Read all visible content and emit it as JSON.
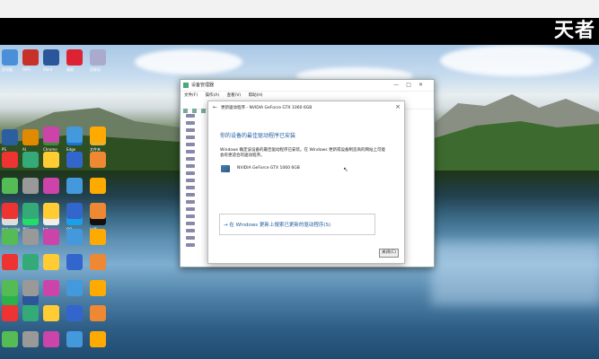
{
  "brand_text": "天者",
  "device_manager": {
    "title": "设备管理器",
    "menu": [
      "文件(F)",
      "操作(A)",
      "查看(V)",
      "帮助(H)"
    ],
    "controls": [
      "—",
      "□",
      "✕"
    ]
  },
  "update_dialog": {
    "title": "更新驱动程序 - NVIDIA GeForce GTX 1060 6GB",
    "heading": "你的设备的最佳驱动程序已安装",
    "description": "Windows 确定该设备的最佳驱动程序已安装。在 Windows 更新或设备制造商的网站上可能会有更适合的驱动程序。",
    "device_name": "NVIDIA GeForce GTX 1060 6GB",
    "option_label": "→ 在 Windows 更新上搜索已更新的驱动程序(S)",
    "close_button": "关闭(C)"
  },
  "desktop_icons": [
    {
      "label": "此电脑",
      "color": "#4a90d9"
    },
    {
      "label": "WPS",
      "color": "#c8302a"
    },
    {
      "label": "Word",
      "color": "#2b579a"
    },
    {
      "label": "美图",
      "color": "#d23"
    },
    {
      "label": "回收站",
      "color": "#aac"
    },
    {
      "label": "PS",
      "color": "#2a5fa0"
    },
    {
      "label": "AI",
      "color": "#e08a00"
    },
    {
      "label": "Chrome",
      "color": "#3b8f3b"
    },
    {
      "label": "Edge",
      "color": "#1a73d8"
    },
    {
      "label": "文件夹",
      "color": "#e3b341"
    },
    {
      "label": "debug.log",
      "color": "#ddd"
    },
    {
      "label": "音乐",
      "color": "#2d6"
    },
    {
      "label": "txt",
      "color": "#eee"
    },
    {
      "label": "QQ",
      "color": "#1aa0e6"
    },
    {
      "label": "抖音",
      "color": "#111"
    },
    {
      "label": "微信",
      "color": "#2bb24c"
    },
    {
      "label": "docx",
      "color": "#2b579a"
    }
  ]
}
